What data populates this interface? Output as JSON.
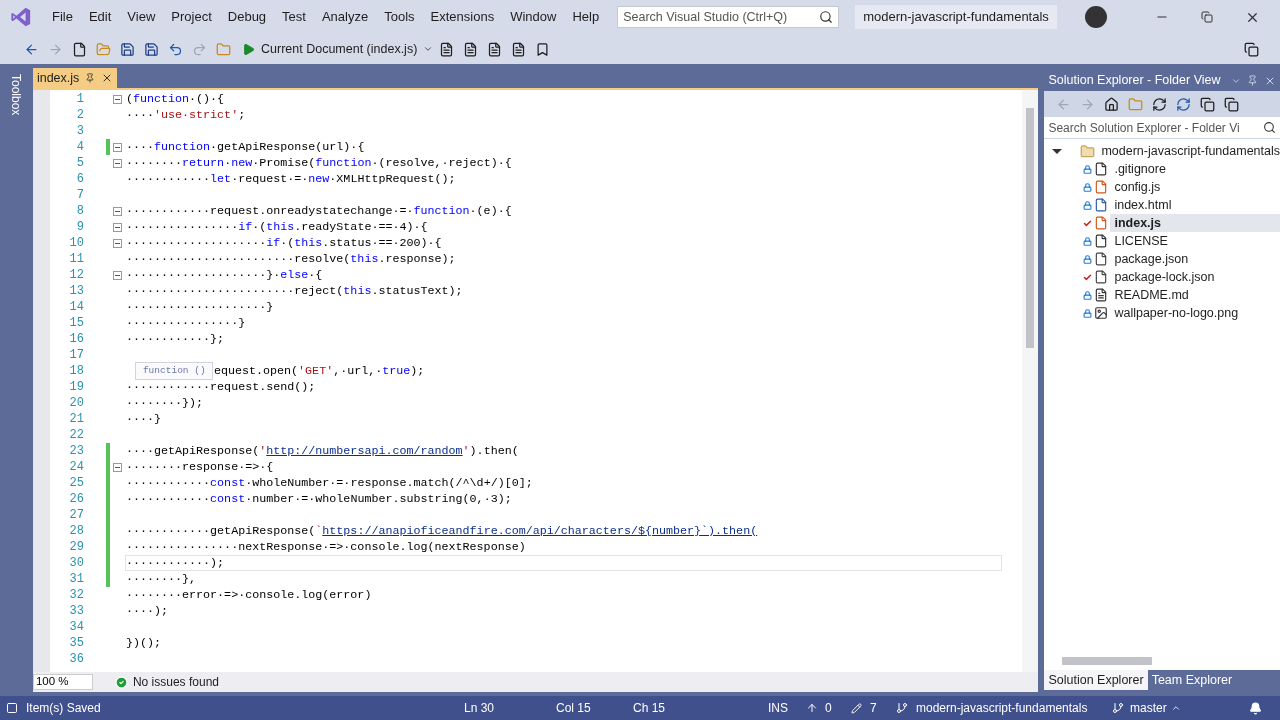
{
  "menu": [
    "File",
    "Edit",
    "View",
    "Project",
    "Debug",
    "Test",
    "Analyze",
    "Tools",
    "Extensions",
    "Window",
    "Help"
  ],
  "search": {
    "placeholder": "Search Visual Studio (Ctrl+Q)"
  },
  "solution_name": "modern-javascript-fundamentals",
  "toolbar": {
    "run_target": "Current Document (index.js)"
  },
  "toolbox_label": "Toolbox",
  "tabs": [
    {
      "label": "index.js",
      "selected": true
    }
  ],
  "editor": {
    "lines": [
      {
        "number": "1",
        "fold": true,
        "changed": false,
        "current": false,
        "segments": [
          {
            "kind": "plain",
            "text": "("
          },
          {
            "kind": "keyword",
            "text": "function"
          },
          {
            "kind": "plain",
            "text": "·()·{"
          }
        ]
      },
      {
        "number": "2",
        "fold": false,
        "changed": false,
        "current": false,
        "segments": [
          {
            "kind": "plain",
            "text": "····"
          },
          {
            "kind": "string",
            "text": "'use·strict'"
          },
          {
            "kind": "plain",
            "text": ";"
          }
        ]
      },
      {
        "number": "3",
        "fold": false,
        "changed": false,
        "current": false
      },
      {
        "number": "4",
        "fold": true,
        "changed": true,
        "current": false,
        "segments": [
          {
            "kind": "plain",
            "text": "····"
          },
          {
            "kind": "keyword",
            "text": "function"
          },
          {
            "kind": "plain",
            "text": "·getApiResponse(url)·{"
          }
        ]
      },
      {
        "number": "5",
        "fold": true,
        "changed": false,
        "current": false,
        "segments": [
          {
            "kind": "plain",
            "text": "········"
          },
          {
            "kind": "keyword",
            "text": "return"
          },
          {
            "kind": "plain",
            "text": "·"
          },
          {
            "kind": "keyword",
            "text": "new"
          },
          {
            "kind": "plain",
            "text": "·Promise("
          },
          {
            "kind": "keyword",
            "text": "function"
          },
          {
            "kind": "plain",
            "text": "·(resolve,·reject)·{"
          }
        ]
      },
      {
        "number": "6",
        "fold": false,
        "changed": false,
        "current": false,
        "segments": [
          {
            "kind": "plain",
            "text": "············"
          },
          {
            "kind": "keyword",
            "text": "let"
          },
          {
            "kind": "plain",
            "text": "·request·=·"
          },
          {
            "kind": "keyword",
            "text": "new"
          },
          {
            "kind": "plain",
            "text": "·XMLHttpRequest();"
          }
        ]
      },
      {
        "number": "7",
        "fold": false,
        "changed": false,
        "current": false
      },
      {
        "number": "8",
        "fold": true,
        "changed": false,
        "current": false,
        "segments": [
          {
            "kind": "plain",
            "text": "············request.onreadystatechange·=·"
          },
          {
            "kind": "keyword",
            "text": "function"
          },
          {
            "kind": "plain",
            "text": "·(e)·{"
          }
        ]
      },
      {
        "number": "9",
        "fold": true,
        "changed": false,
        "current": false,
        "segments": [
          {
            "kind": "plain",
            "text": "················"
          },
          {
            "kind": "keyword",
            "text": "if"
          },
          {
            "kind": "plain",
            "text": "·("
          },
          {
            "kind": "keyword",
            "text": "this"
          },
          {
            "kind": "plain",
            "text": ".readyState·==·4)·{"
          }
        ]
      },
      {
        "number": "10",
        "fold": true,
        "changed": false,
        "current": false,
        "segments": [
          {
            "kind": "plain",
            "text": "····················"
          },
          {
            "kind": "keyword",
            "text": "if"
          },
          {
            "kind": "plain",
            "text": "·("
          },
          {
            "kind": "keyword",
            "text": "this"
          },
          {
            "kind": "plain",
            "text": ".status·==·200)·{"
          }
        ]
      },
      {
        "number": "11",
        "fold": false,
        "changed": false,
        "current": false,
        "segments": [
          {
            "kind": "plain",
            "text": "························resolve("
          },
          {
            "kind": "keyword",
            "text": "this"
          },
          {
            "kind": "plain",
            "text": ".response);"
          }
        ]
      },
      {
        "number": "12",
        "fold": true,
        "changed": false,
        "current": false,
        "segments": [
          {
            "kind": "plain",
            "text": "····················}·"
          },
          {
            "kind": "keyword",
            "text": "else"
          },
          {
            "kind": "plain",
            "text": "·{"
          }
        ]
      },
      {
        "number": "13",
        "fold": false,
        "changed": false,
        "current": false,
        "segments": [
          {
            "kind": "plain",
            "text": "························reject("
          },
          {
            "kind": "keyword",
            "text": "this"
          },
          {
            "kind": "plain",
            "text": ".statusText);"
          }
        ]
      },
      {
        "number": "14",
        "fold": false,
        "changed": false,
        "current": false,
        "segments": [
          {
            "kind": "plain",
            "text": "····················}"
          }
        ]
      },
      {
        "number": "15",
        "fold": false,
        "changed": false,
        "current": false,
        "segments": [
          {
            "kind": "plain",
            "text": "················}"
          }
        ]
      },
      {
        "number": "16",
        "fold": false,
        "changed": false,
        "current": false,
        "segments": [
          {
            "kind": "plain",
            "text": "············};"
          }
        ]
      },
      {
        "number": "17",
        "fold": false,
        "changed": false,
        "current": false
      },
      {
        "number": "18",
        "fold": false,
        "changed": false,
        "current": false,
        "peek": "function ()",
        "segments": [
          {
            "kind": "plain",
            "text": "equest.open("
          },
          {
            "kind": "string",
            "text": "'GET'"
          },
          {
            "kind": "plain",
            "text": ",·url,·"
          },
          {
            "kind": "keyword",
            "text": "true"
          },
          {
            "kind": "plain",
            "text": ");"
          }
        ]
      },
      {
        "number": "19",
        "fold": false,
        "changed": false,
        "current": false,
        "segments": [
          {
            "kind": "plain",
            "text": "············request.send();"
          }
        ]
      },
      {
        "number": "20",
        "fold": false,
        "changed": false,
        "current": false,
        "segments": [
          {
            "kind": "plain",
            "text": "········});"
          }
        ]
      },
      {
        "number": "21",
        "fold": false,
        "changed": false,
        "current": false,
        "segments": [
          {
            "kind": "plain",
            "text": "····}"
          }
        ]
      },
      {
        "number": "22",
        "fold": false,
        "changed": false,
        "current": false
      },
      {
        "number": "23",
        "fold": false,
        "changed": true,
        "current": false,
        "segments": [
          {
            "kind": "plain",
            "text": "····getApiResponse("
          },
          {
            "kind": "string",
            "text": "'"
          },
          {
            "kind": "link",
            "text": "http://numbersapi.com/random"
          },
          {
            "kind": "string",
            "text": "'"
          },
          {
            "kind": "plain",
            "text": ").then("
          }
        ]
      },
      {
        "number": "24",
        "fold": true,
        "changed": true,
        "current": false,
        "segments": [
          {
            "kind": "plain",
            "text": "········response·=>·{"
          }
        ]
      },
      {
        "number": "25",
        "fold": false,
        "changed": true,
        "current": false,
        "segments": [
          {
            "kind": "plain",
            "text": "············"
          },
          {
            "kind": "keyword",
            "text": "const"
          },
          {
            "kind": "plain",
            "text": "·wholeNumber·=·response.match(/^\\d+/)[0];"
          }
        ]
      },
      {
        "number": "26",
        "fold": false,
        "changed": true,
        "current": false,
        "segments": [
          {
            "kind": "plain",
            "text": "············"
          },
          {
            "kind": "keyword",
            "text": "const"
          },
          {
            "kind": "plain",
            "text": "·number·=·wholeNumber.substring(0,·3);"
          }
        ]
      },
      {
        "number": "27",
        "fold": false,
        "changed": true,
        "current": false
      },
      {
        "number": "28",
        "fold": false,
        "changed": true,
        "current": false,
        "segments": [
          {
            "kind": "plain",
            "text": "············getApiResponse("
          },
          {
            "kind": "string",
            "text": "`"
          },
          {
            "kind": "link",
            "text": "https://anapioficeandfire.com/api/characters/${number}`).then("
          }
        ]
      },
      {
        "number": "29",
        "fold": false,
        "changed": true,
        "current": false,
        "segments": [
          {
            "kind": "plain",
            "text": "················nextResponse·=>·console.log(nextResponse)"
          }
        ]
      },
      {
        "number": "30",
        "fold": false,
        "changed": true,
        "current": true,
        "segments": [
          {
            "kind": "plain",
            "text": "············);"
          }
        ]
      },
      {
        "number": "31",
        "fold": false,
        "changed": true,
        "current": false,
        "segments": [
          {
            "kind": "plain",
            "text": "········},"
          }
        ]
      },
      {
        "number": "32",
        "fold": false,
        "changed": false,
        "current": false,
        "segments": [
          {
            "kind": "plain",
            "text": "········error·=>·console.log(error)"
          }
        ]
      },
      {
        "number": "33",
        "fold": false,
        "changed": false,
        "current": false,
        "segments": [
          {
            "kind": "plain",
            "text": "····);"
          }
        ]
      },
      {
        "number": "34",
        "fold": false,
        "changed": false,
        "current": false
      },
      {
        "number": "35",
        "fold": false,
        "changed": false,
        "current": false,
        "segments": [
          {
            "kind": "plain",
            "text": "})();"
          }
        ]
      },
      {
        "number": "36",
        "fold": false,
        "changed": false,
        "current": false
      }
    ],
    "zoom": "100 %",
    "issues": "No issues found"
  },
  "solution_explorer": {
    "title": "Solution Explorer - Folder View",
    "search_placeholder": "Search Solution Explorer - Folder Vi",
    "root": {
      "name": "modern-javascript-fundamentals",
      "expanded": true,
      "children": [
        {
          "name": ".gitignore",
          "kind": "file",
          "modified": false,
          "selected": false
        },
        {
          "name": "config.js",
          "kind": "script",
          "modified": false,
          "selected": false
        },
        {
          "name": "index.html",
          "kind": "web",
          "modified": false,
          "selected": false
        },
        {
          "name": "index.js",
          "kind": "script",
          "modified": true,
          "selected": true
        },
        {
          "name": "LICENSE",
          "kind": "file",
          "modified": false,
          "selected": false
        },
        {
          "name": "package.json",
          "kind": "config",
          "modified": false,
          "selected": false
        },
        {
          "name": "package-lock.json",
          "kind": "config",
          "modified": true,
          "selected": false
        },
        {
          "name": "README.md",
          "kind": "text",
          "modified": false,
          "selected": false
        },
        {
          "name": "wallpaper-no-logo.png",
          "kind": "image",
          "modified": false,
          "selected": false
        }
      ]
    },
    "tabs": [
      {
        "label": "Solution Explorer",
        "selected": true
      },
      {
        "label": "Team Explorer",
        "selected": false
      }
    ]
  },
  "status_bar": {
    "message": "Item(s) Saved",
    "ln": "Ln 30",
    "col": "Col 15",
    "ch": "Ch 15",
    "mode": "INS",
    "pushes": "0",
    "changes": "7",
    "repo": "modern-javascript-fundamentals",
    "branch": "master"
  }
}
